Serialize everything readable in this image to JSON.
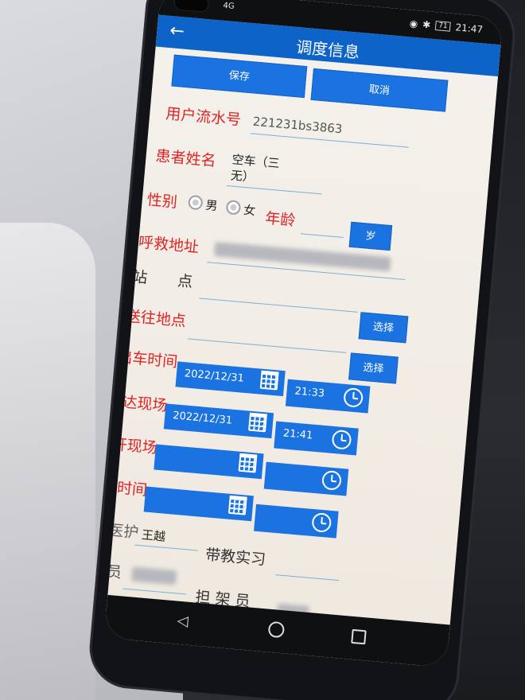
{
  "status": {
    "network": "4G",
    "battery": "71",
    "time": "21:47"
  },
  "header": {
    "title": "调度信息"
  },
  "actions": {
    "save": "保存",
    "cancel": "取消"
  },
  "form": {
    "serial_label": "用户流水号",
    "serial_value": "221231bs3863",
    "patient_label": "患者姓名",
    "patient_value_line1": "空车（三",
    "patient_value_line2": "无）",
    "gender_label": "性别",
    "gender_male": "男",
    "gender_female": "女",
    "age_label": "年龄",
    "age_unit": "岁",
    "address_label": "呼救地址",
    "station_label": "站　　点",
    "destination_label": "送往地点",
    "select_label": "选择",
    "depart_label": "出车时间",
    "depart_date": "2022/12/31",
    "depart_time": "21:33",
    "arrive_label": "到达现场",
    "arrive_date": "2022/12/31",
    "arrive_time": "21:41",
    "leave_label": "离开现场",
    "reach_label": "到达时间",
    "medic_label": "急救医护",
    "medic_value": "王越",
    "trainee_label": "带教实习",
    "driver_label": "驾 驶 员",
    "stretcher_label": "担 架 员"
  },
  "icons": {
    "back": "arrow-left-icon",
    "calendar": "calendar-icon",
    "clock": "clock-icon"
  },
  "colors": {
    "primary": "#1a73e0",
    "label_red": "#e02424",
    "appbar": "#0d63c8"
  }
}
